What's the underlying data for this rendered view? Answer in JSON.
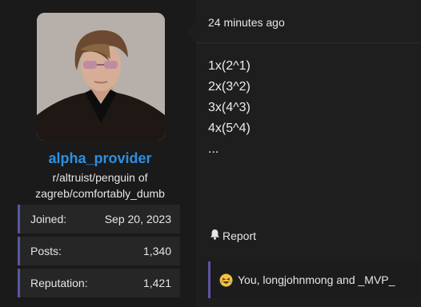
{
  "user": {
    "username": "alpha_provider",
    "title_line1": "r/altruist/penguin of",
    "title_line2": "zagreb/comfortably_dumb",
    "stats": [
      {
        "label": "Joined:",
        "value": "Sep 20, 2023"
      },
      {
        "label": "Posts:",
        "value": "1,340"
      },
      {
        "label": "Reputation:",
        "value": "1,421"
      }
    ],
    "colors": {
      "username": "#2e8fe0",
      "stat_accent": "#5a56a6"
    }
  },
  "post": {
    "timestamp": "24 minutes ago",
    "body_lines": [
      "1x(2^1)",
      "2x(3^2)",
      "3x(4^3)",
      "4x(5^4)",
      "..."
    ],
    "report_label": "Report",
    "report_icon": "bell-icon",
    "reaction_icon": "laughing-face-icon",
    "reactions_text": "You, longjohnmong and _MVP_"
  }
}
